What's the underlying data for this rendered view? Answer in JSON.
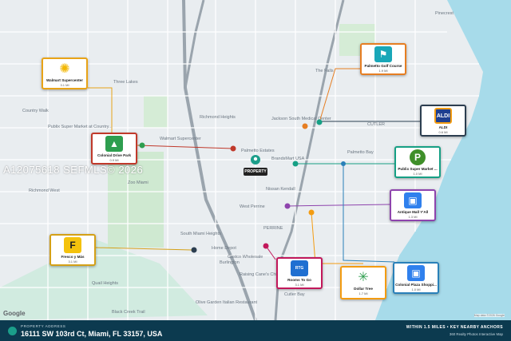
{
  "watermark": "A12075618  SEFMLS© 2026",
  "property_marker": "PROPERTY",
  "map_provider": "Google",
  "attribution": "Map data ©2026 Google",
  "footer": {
    "label": "PROPERTY ADDRESS",
    "address": "16111 SW 103rd Ct, Miami, FL 33157, USA",
    "headline": "WITHIN 1.5 MILES • KEY NEARBY ANCHORS",
    "subline": "360 Realty Photos Interactive Map"
  },
  "place_labels": [
    {
      "text": "Three Lakes"
    },
    {
      "text": "Country Walk"
    },
    {
      "text": "Richmond Heights"
    },
    {
      "text": "Palmetto Estates"
    },
    {
      "text": "Palmetto Bay"
    },
    {
      "text": "CUTLER"
    },
    {
      "text": "Richmond West"
    },
    {
      "text": "West Perrine"
    },
    {
      "text": "South Miami Heights"
    },
    {
      "text": "Cutler Bay"
    },
    {
      "text": "Quail Heights"
    },
    {
      "text": "Pinecrest"
    },
    {
      "text": "PERRINE"
    },
    {
      "text": "Zoo Miami"
    },
    {
      "text": "Black Creek Trail"
    },
    {
      "text": "The Falls"
    },
    {
      "text": "Jackson South Medical Center"
    },
    {
      "text": "Publix Super Market at Country..."
    },
    {
      "text": "Nissan Kendall"
    },
    {
      "text": "Olive Garden Italian Restaurant"
    },
    {
      "text": "Raising Cane's Chicken Fingers"
    },
    {
      "text": "Walmart Supercenter"
    },
    {
      "text": "Costco Wholesale"
    },
    {
      "text": "Burlington"
    },
    {
      "text": "BrandsMart USA"
    },
    {
      "text": "Home Depot"
    }
  ],
  "anchors": [
    {
      "name": "Walmart Supercenter",
      "distance": "3.1 MI",
      "icon": "walmart-spark-icon",
      "color": "#0071ce",
      "border": "#e8a317"
    },
    {
      "name": "Colonial Drive Park",
      "distance": "0.9 MI",
      "icon": "tree-icon",
      "color": "#2e9e4f",
      "border": "#c0392b"
    },
    {
      "name": "Palmetto Golf Course",
      "distance": "1.9 MI",
      "icon": "golf-flag-icon",
      "color": "#19a7b8",
      "border": "#e67e22"
    },
    {
      "name": "ALDI",
      "distance": "0.6 MI",
      "icon": "aldi-logo-icon",
      "color": "#1f3f8f",
      "border": "#2c3e50"
    },
    {
      "name": "Publix Super Market ...",
      "distance": "1.0 MI",
      "icon": "publix-logo-icon",
      "color": "#3f8f29",
      "border": "#16a085"
    },
    {
      "name": "Antique Mall Y'All",
      "distance": "1.3 MI",
      "icon": "shopping-bag-icon",
      "color": "#2f80ed",
      "border": "#8e44ad"
    },
    {
      "name": "Fresco y Más",
      "distance": "3.1 MI",
      "icon": "fresco-logo-icon",
      "color": "#f4c20d",
      "border": "#d4a017"
    },
    {
      "name": "Rooms To Go",
      "distance": "3.1 MI",
      "icon": "rooms-to-go-logo-icon",
      "color": "#1f6fd1",
      "border": "#c2185b"
    },
    {
      "name": "Dollar Tree",
      "distance": "1.7 MI",
      "icon": "palm-tree-icon",
      "color": "#2e9e4f",
      "border": "#f39c12"
    },
    {
      "name": "Colonial Plaza Shoppi...",
      "distance": "1.0 MI",
      "icon": "shopping-bag-icon",
      "color": "#2f80ed",
      "border": "#2980b9"
    }
  ]
}
